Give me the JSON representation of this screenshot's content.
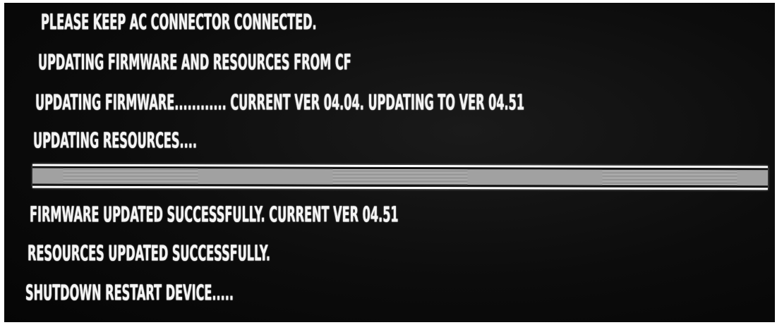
{
  "screen": {
    "lines_before_progress": [
      "PLEASE KEEP AC CONNECTOR CONNECTED.",
      "UPDATING FIRMWARE AND RESOURCES FROM CF",
      "UPDATING FIRMWARE............ CURRENT VER 04.04. UPDATING TO VER 04.51",
      "UPDATING RESOURCES...."
    ],
    "progress": {
      "fraction": 1.0
    },
    "lines_after_progress": [
      "FIRMWARE UPDATED SUCCESSFULLY. CURRENT VER 04.51",
      "RESOURCES UPDATED SUCCESSFULLY.",
      "SHUTDOWN RESTART DEVICE....."
    ]
  },
  "colors": {
    "background": "#0c0c0c",
    "text": "#f4f4f4",
    "bar_border": "#ffffff"
  }
}
